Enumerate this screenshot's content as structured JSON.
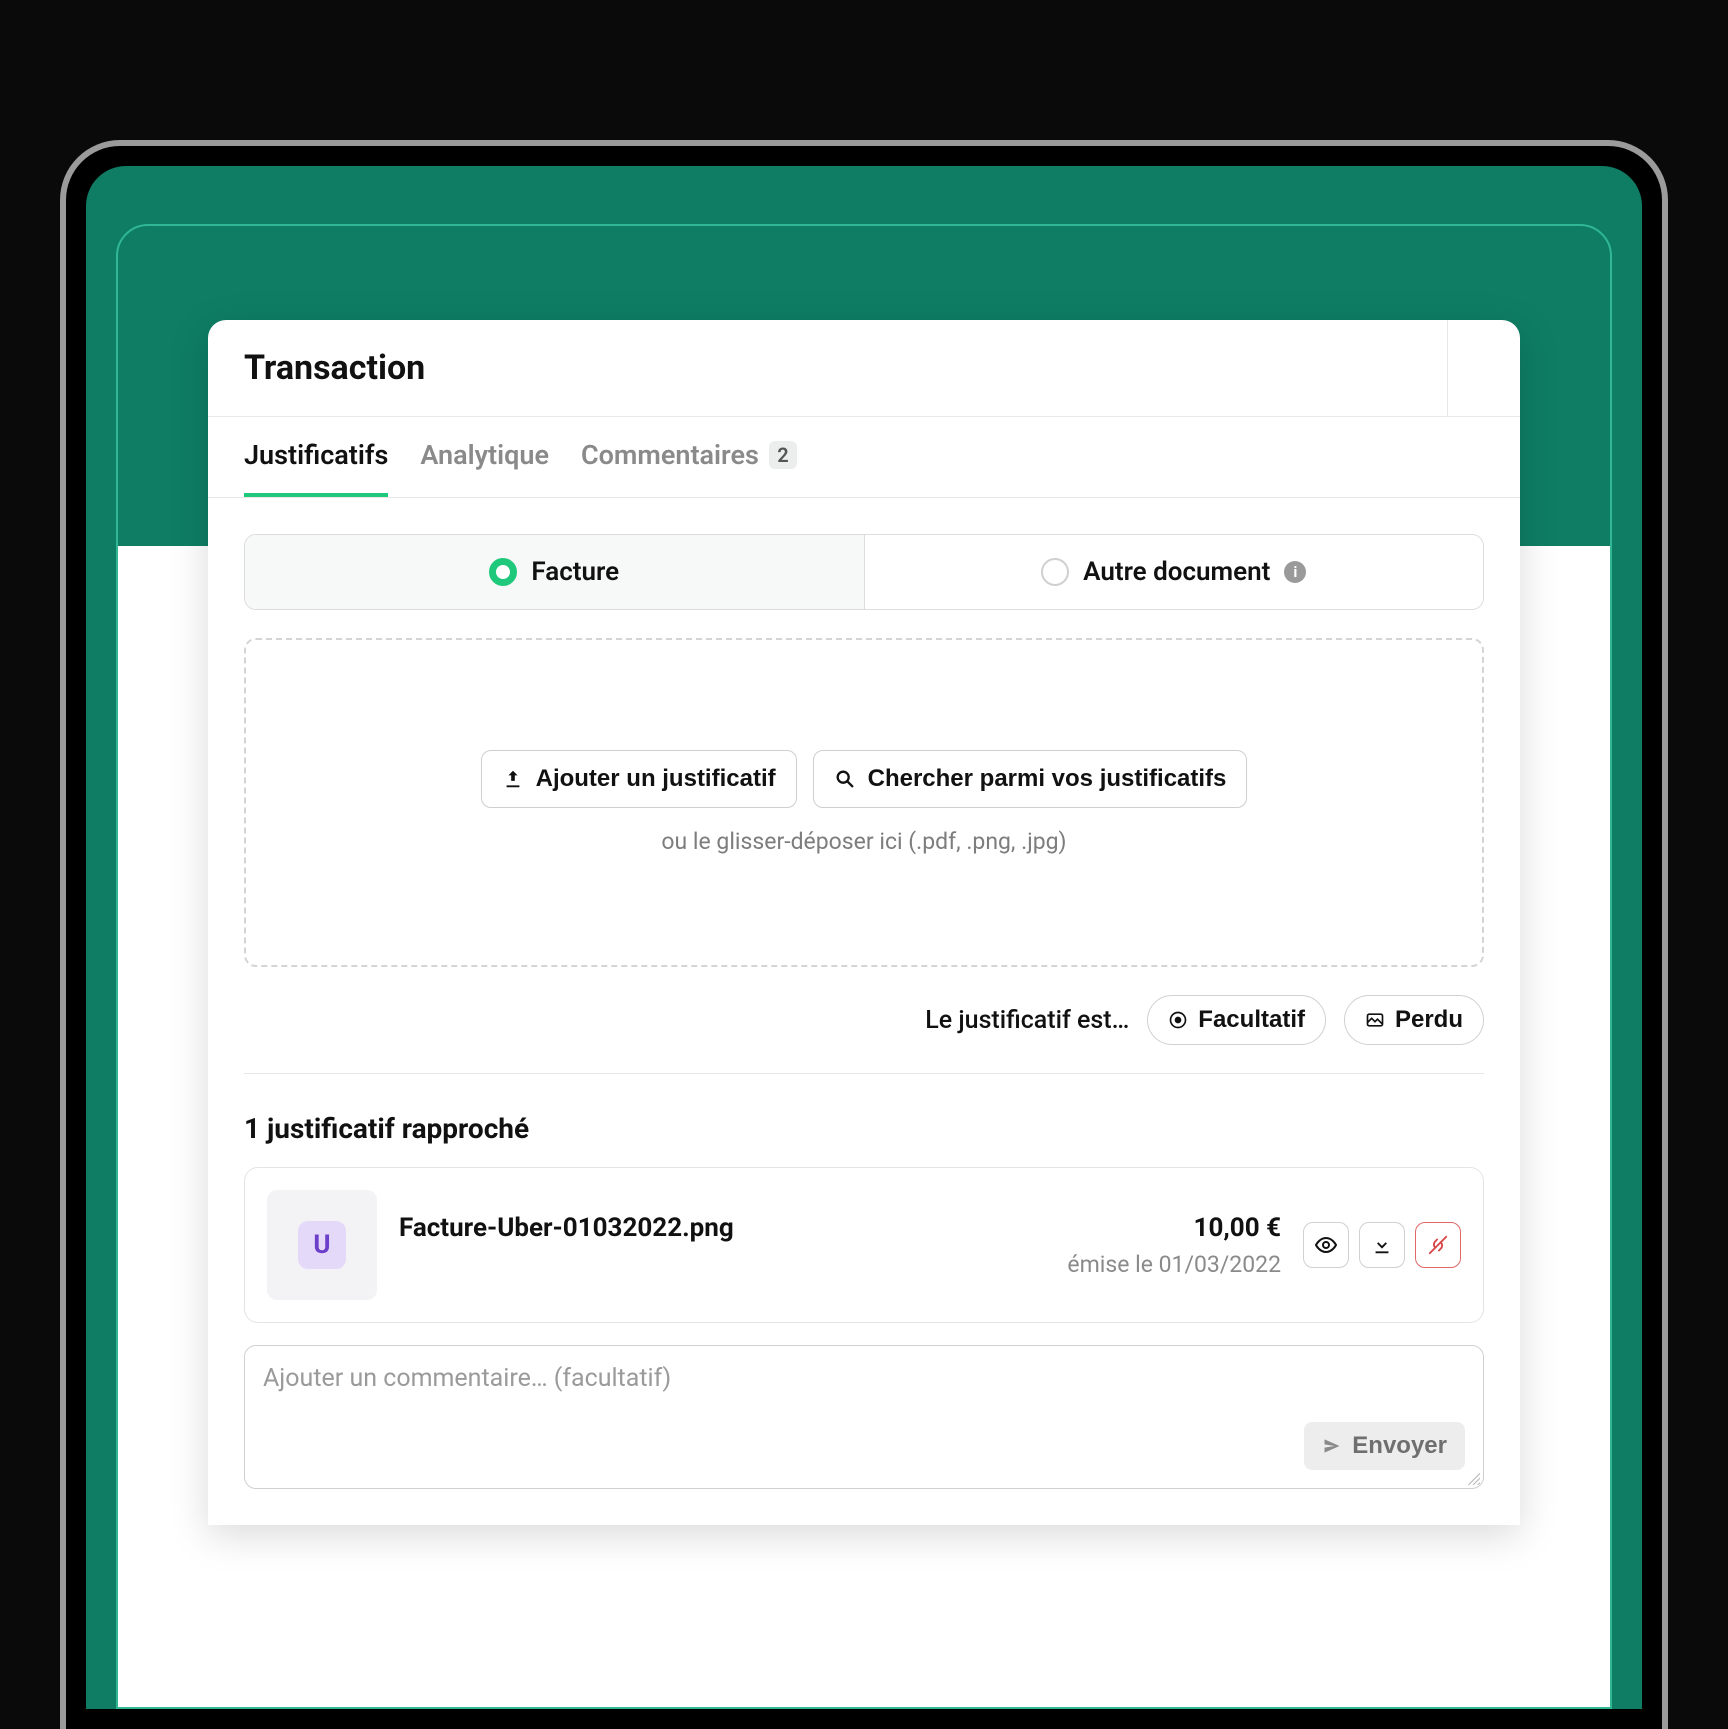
{
  "modal": {
    "title": "Transaction"
  },
  "tabs": {
    "justificatifs": "Justificatifs",
    "analytique": "Analytique",
    "commentaires": "Commentaires",
    "commentaires_count": "2"
  },
  "doc_type": {
    "facture": "Facture",
    "autre": "Autre document"
  },
  "dropzone": {
    "add_button": "Ajouter un justificatif",
    "search_button": "Chercher parmi vos justificatifs",
    "hint": "ou le glisser-déposer ici (.pdf, .png, .jpg)"
  },
  "status": {
    "label": "Le justificatif est…",
    "facultatif": "Facultatif",
    "perdu": "Perdu"
  },
  "attached": {
    "section_title": "1 justificatif rapproché",
    "badge_letter": "U",
    "file_name": "Facture-Uber-01032022.png",
    "amount": "10,00 €",
    "issued": "émise le 01/03/2022"
  },
  "comment": {
    "placeholder": "Ajouter un commentaire… (facultatif)",
    "send": "Envoyer"
  }
}
